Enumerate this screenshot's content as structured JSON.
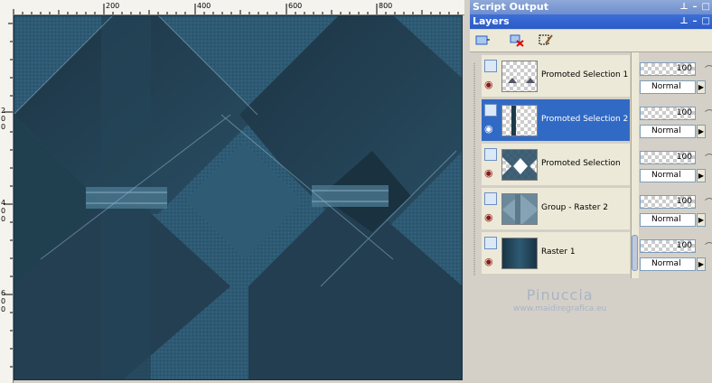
{
  "ruler": {
    "top_labels": [
      "200",
      "400",
      "600",
      "800"
    ],
    "left_labels": [
      "2",
      "0",
      "0",
      "4",
      "0",
      "0",
      "6",
      "0",
      "0"
    ]
  },
  "panels": {
    "script_output_title": "Script Output",
    "layers_title": "Layers"
  },
  "toolbar": {
    "new_layer_icon": "new-layer-icon",
    "delete_layer_icon": "delete-layer-icon",
    "edit_selection_icon": "edit-selection-icon"
  },
  "layers": [
    {
      "name": "Promoted Selection 1",
      "opacity": "100",
      "blend": "Normal",
      "selected": false
    },
    {
      "name": "Promoted Selection 2",
      "opacity": "100",
      "blend": "Normal",
      "selected": true
    },
    {
      "name": "Promoted Selection",
      "opacity": "100",
      "blend": "Normal",
      "selected": false
    },
    {
      "name": "Group - Raster 2",
      "opacity": "100",
      "blend": "Normal",
      "selected": false
    },
    {
      "name": "Raster 1",
      "opacity": "100",
      "blend": "Normal",
      "selected": false
    }
  ],
  "watermark": {
    "name": "Pinuccia",
    "url": "www.maidiregrafica.eu"
  },
  "colors": {
    "canvas_base": "#2d5268",
    "selection": "#316ac5"
  }
}
